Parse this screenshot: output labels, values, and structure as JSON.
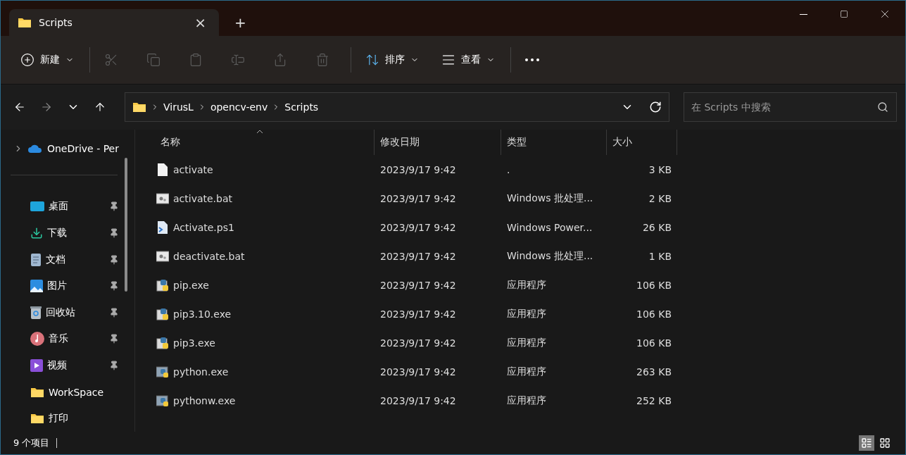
{
  "tab": {
    "title": "Scripts",
    "close": "×",
    "new_tab": "+"
  },
  "toolbar": {
    "items": [
      {
        "kind": "new",
        "label": "新建",
        "disabled": false
      },
      {
        "kind": "cut",
        "disabled": true
      },
      {
        "kind": "copy",
        "disabled": true
      },
      {
        "kind": "paste",
        "disabled": true
      },
      {
        "kind": "rename",
        "disabled": true
      },
      {
        "kind": "share",
        "disabled": true
      },
      {
        "kind": "delete",
        "disabled": true
      },
      {
        "kind": "sort",
        "label": "排序",
        "disabled": false
      },
      {
        "kind": "view",
        "label": "查看",
        "disabled": false
      },
      {
        "kind": "more",
        "disabled": false
      }
    ]
  },
  "nav": {
    "back_disabled": false,
    "forward_disabled": true,
    "breadcrumb": [
      "VirusL",
      "opencv-env",
      "Scripts"
    ],
    "search": {
      "placeholder": "在 Scripts 中搜索"
    }
  },
  "sidebar": {
    "items": [
      {
        "kind": "onedrive",
        "label": "OneDrive - Per",
        "pinned": false
      },
      {
        "kind": "desktop",
        "label": "桌面",
        "pinned": true
      },
      {
        "kind": "download",
        "label": "下载",
        "pinned": true
      },
      {
        "kind": "documents",
        "label": "文档",
        "pinned": true
      },
      {
        "kind": "pictures",
        "label": "图片",
        "pinned": true
      },
      {
        "kind": "recycle",
        "label": "回收站",
        "pinned": true
      },
      {
        "kind": "music",
        "label": "音乐",
        "pinned": true
      },
      {
        "kind": "video",
        "label": "视频",
        "pinned": true
      },
      {
        "kind": "folder",
        "label": "WorkSpace",
        "pinned": false
      },
      {
        "kind": "folder",
        "label": "打印",
        "pinned": false
      }
    ]
  },
  "table": {
    "columns": [
      "名称",
      "修改日期",
      "类型",
      "大小"
    ],
    "rows": [
      {
        "kind": "text",
        "name": "activate",
        "modified": "2023/9/17 9:42",
        "type": ".",
        "size": "3 KB"
      },
      {
        "kind": "batch",
        "name": "activate.bat",
        "modified": "2023/9/17 9:42",
        "type": "Windows 批处理...",
        "size": "2 KB"
      },
      {
        "kind": "script",
        "name": "Activate.ps1",
        "modified": "2023/9/17 9:42",
        "type": "Windows Power...",
        "size": "26 KB"
      },
      {
        "kind": "batch",
        "name": "deactivate.bat",
        "modified": "2023/9/17 9:42",
        "type": "Windows 批处理...",
        "size": "1 KB"
      },
      {
        "kind": "installer",
        "name": "pip.exe",
        "modified": "2023/9/17 9:42",
        "type": "应用程序",
        "size": "106 KB"
      },
      {
        "kind": "installer",
        "name": "pip3.10.exe",
        "modified": "2023/9/17 9:42",
        "type": "应用程序",
        "size": "106 KB"
      },
      {
        "kind": "installer",
        "name": "pip3.exe",
        "modified": "2023/9/17 9:42",
        "type": "应用程序",
        "size": "106 KB"
      },
      {
        "kind": "python",
        "name": "python.exe",
        "modified": "2023/9/17 9:42",
        "type": "应用程序",
        "size": "263 KB"
      },
      {
        "kind": "python",
        "name": "pythonw.exe",
        "modified": "2023/9/17 9:42",
        "type": "应用程序",
        "size": "252 KB"
      }
    ]
  },
  "status_bar": {
    "count": "9 个项目",
    "views": [
      {
        "kind": "details",
        "selected": true
      },
      {
        "kind": "tiles",
        "selected": false
      }
    ]
  }
}
